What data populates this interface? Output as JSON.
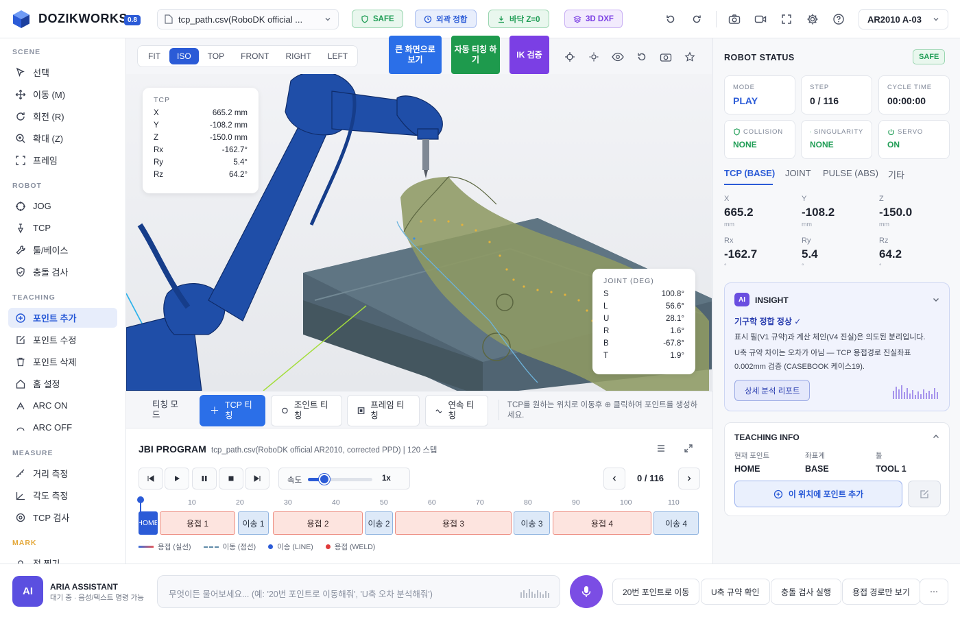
{
  "header": {
    "brand": "DOZIKWORKS",
    "version": "0.8",
    "file_name": "tcp_path.csv(RoboDK official ...",
    "badges": [
      {
        "label": "SAFE",
        "color": "#1f9d55"
      },
      {
        "label": "외곽 정합",
        "color": "#2b5bd7"
      },
      {
        "label": "바닥 Z=0",
        "color": "#1f9d55"
      },
      {
        "label": "3D DXF",
        "color": "#7b3fe4"
      }
    ],
    "robot_model": "AR2010 A-03"
  },
  "sidebar": {
    "sections": {
      "scene": "SCENE",
      "robot": "ROBOT",
      "teaching": "TEACHING",
      "measure": "MEASURE",
      "mark": "MARK"
    },
    "scene_items": [
      "선택",
      "이동 (M)",
      "회전 (R)",
      "확대 (Z)",
      "프레임"
    ],
    "robot_items": [
      "JOG",
      "TCP",
      "툴/베이스",
      "충돌 검사"
    ],
    "teaching_items": [
      "포인트 추가",
      "포인트 수정",
      "포인트 삭제",
      "홈 설정",
      "ARC ON",
      "ARC OFF"
    ],
    "measure_items": [
      "거리 측정",
      "각도 측정",
      "TCP 검사"
    ],
    "mark_items": [
      "점 찍기"
    ]
  },
  "viewport": {
    "views": [
      "FIT",
      "ISO",
      "TOP",
      "FRONT",
      "RIGHT",
      "LEFT"
    ],
    "active_view": "ISO",
    "big_buttons": [
      {
        "label": "큰 화면으로 보기",
        "color": "#2b6fe8"
      },
      {
        "label": "자동 티칭 하기",
        "color": "#1e9a4d"
      },
      {
        "label": "IK 검증",
        "color": "#7b3fe4"
      }
    ],
    "tcp_card": {
      "title": "TCP",
      "rows": [
        {
          "k": "X",
          "v": "665.2 mm"
        },
        {
          "k": "Y",
          "v": "-108.2 mm"
        },
        {
          "k": "Z",
          "v": "-150.0 mm"
        },
        {
          "k": "Rx",
          "v": "-162.7°"
        },
        {
          "k": "Ry",
          "v": "5.4°"
        },
        {
          "k": "Rz",
          "v": "64.2°"
        }
      ]
    },
    "joint_card": {
      "title": "JOINT (DEG)",
      "rows": [
        {
          "k": "S",
          "v": "100.8°"
        },
        {
          "k": "L",
          "v": "56.6°"
        },
        {
          "k": "U",
          "v": "28.1°"
        },
        {
          "k": "R",
          "v": "1.6°"
        },
        {
          "k": "B",
          "v": "-67.8°"
        },
        {
          "k": "T",
          "v": "1.9°"
        }
      ]
    }
  },
  "teach_bar": {
    "mode_label": "티칭 모드",
    "buttons": [
      "TCP 티칭",
      "조인트 티칭",
      "프레임 티칭",
      "연속 티칭"
    ],
    "hint": "TCP를 원하는 위치로 이동후 ⊕ 클릭하여 포인트를 생성하세요."
  },
  "jbi": {
    "title": "JBI PROGRAM",
    "subtitle": "tcp_path.csv(RoboDK official AR2010, corrected PPD) | 120 스텝",
    "speed_label": "속도",
    "speed_value": "1x",
    "speed_fraction": 0.25,
    "step_counter": "0 / 116",
    "ticks": [
      "10",
      "20",
      "30",
      "40",
      "50",
      "60",
      "70",
      "80",
      "90",
      "100",
      "110"
    ],
    "segments": [
      "HOME",
      "용접 1",
      "이송 1",
      "용접 2",
      "이송 2",
      "용접 3",
      "이송 3",
      "용접 4",
      "이송 4"
    ],
    "legend": [
      "용접 (실선)",
      "이동 (점선)",
      "이송 (LINE)",
      "용접 (WELD)"
    ]
  },
  "robot_status": {
    "title": "ROBOT STATUS",
    "safe": "SAFE",
    "stats": [
      {
        "label": "MODE",
        "value": "PLAY"
      },
      {
        "label": "STEP",
        "value": "0 / 116"
      },
      {
        "label": "CYCLE TIME",
        "value": "00:00:00"
      },
      {
        "label": "COLLISION",
        "value": "NONE"
      },
      {
        "label": "SINGULARITY",
        "value": "NONE"
      },
      {
        "label": "SERVO",
        "value": "ON"
      }
    ],
    "tabs": [
      "TCP (BASE)",
      "JOINT",
      "PULSE (ABS)",
      "기타"
    ],
    "coords": [
      {
        "label": "X",
        "value": "665.2",
        "unit": "mm"
      },
      {
        "label": "Y",
        "value": "-108.2",
        "unit": "mm"
      },
      {
        "label": "Z",
        "value": "-150.0",
        "unit": "mm"
      },
      {
        "label": "Rx",
        "value": "-162.7",
        "unit": "°"
      },
      {
        "label": "Ry",
        "value": "5.4",
        "unit": "°"
      },
      {
        "label": "Rz",
        "value": "64.2",
        "unit": "°"
      }
    ]
  },
  "insight": {
    "badge": "AI",
    "title": "INSIGHT",
    "headline": "기구학 정합 정상 ✓",
    "body1": "표시 필(V1 규약)과 계산 체인(V4 진실)은 의도된 분리입니다.",
    "body2": "U축 규약 차이는 오차가 아님 — TCP 용접경로 진실좌표 0.002mm 검증 (CASEBOOK 케이스19).",
    "button": "상세 분석 리포트"
  },
  "teaching_info": {
    "title": "TEACHING INFO",
    "fields": [
      {
        "label": "현재 포인트",
        "value": "HOME"
      },
      {
        "label": "좌표계",
        "value": "BASE"
      },
      {
        "label": "툴",
        "value": "TOOL 1"
      }
    ],
    "add_button": "이 위치에 포인트 추가"
  },
  "assistant": {
    "avatar": "AI",
    "name": "ARIA ASSISTANT",
    "status": "대기 중 · 음성/텍스트 명령 가능",
    "placeholder": "무엇이든 물어보세요... (예: '20번 포인트로 이동해줘', 'U축 오차 분석해줘')",
    "chips": [
      "20번 포인트로 이동",
      "U축 규약 확인",
      "충돌 검사 실행",
      "용접 경로만 보기"
    ],
    "more": "⋯"
  }
}
